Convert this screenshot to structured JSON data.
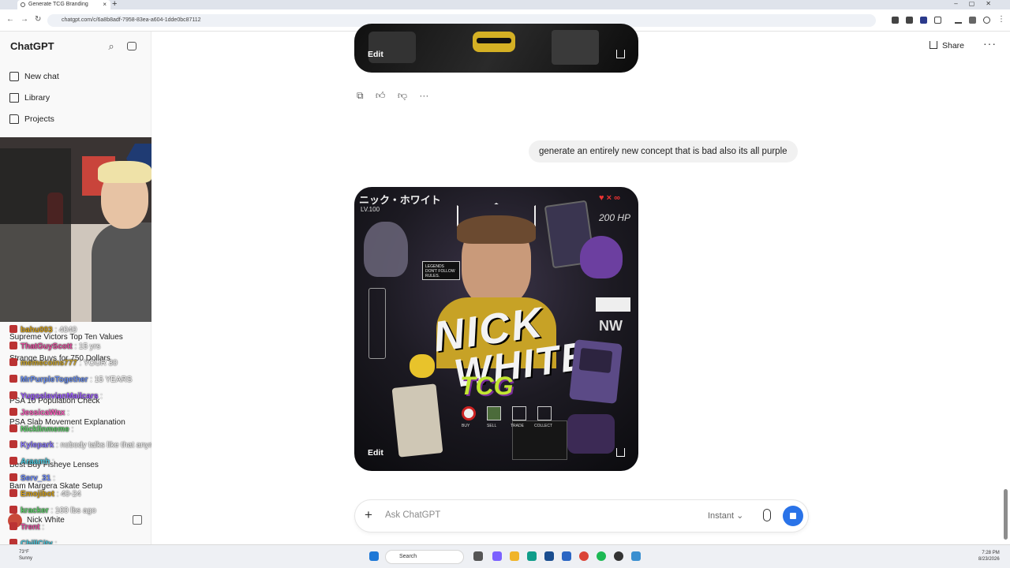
{
  "browser": {
    "tab_title": "Generate TCG Branding",
    "url": "chatgpt.com/c/6a8b8adf-7958-83ea-a604-1dde0bc87112",
    "new_tab": "+",
    "tab_close": "×"
  },
  "sidebar": {
    "brand": "ChatGPT",
    "nav": [
      {
        "label": "New chat"
      },
      {
        "label": "Library"
      },
      {
        "label": "Projects"
      }
    ],
    "history": [
      "Supreme Victors Top Ten Values",
      "Strange Buys for 750 Dollars",
      "PSA 10 Population Check",
      "PSA Slab Movement Explanation",
      "Best Buy Fisheye Lenses",
      "Bam Margera Skate Setup"
    ],
    "user_name": "Nick White"
  },
  "stream_chat": [
    {
      "user": "bahu003",
      "msg": ": 4040",
      "color": "#d4a017"
    },
    {
      "user": "ThatGuyScott",
      "msg": ": 15 yrs",
      "color": "#e54e9e"
    },
    {
      "user": "memecoins777",
      "msg": ": YOUR 30",
      "color": "#c9a227"
    },
    {
      "user": "MrPurpleTogether",
      "msg": ": 15 YEARS",
      "color": "#6b8ff0"
    },
    {
      "user": "YugoslavianMailcars",
      "msg": ":",
      "color": "#9b59ff"
    },
    {
      "user": "JessicaWax",
      "msg": ":",
      "color": "#ff5fbf"
    },
    {
      "user": "Nicklinmeme",
      "msg": ":",
      "color": "#5fd36b"
    },
    {
      "user": "Kylepark",
      "msg": ": nobody talks like that anymore",
      "color": "#8e7cff"
    },
    {
      "user": "Araamh",
      "msg": ":",
      "color": "#48c4d9"
    },
    {
      "user": "Serv_31",
      "msg": ":",
      "color": "#6e8cff"
    },
    {
      "user": "Emojibot",
      "msg": ": 40-24",
      "color": "#d4a017"
    },
    {
      "user": "kracker",
      "msg": ": 100 lbs ago",
      "color": "#5fd36b"
    },
    {
      "user": "Trent",
      "msg": ":",
      "color": "#e54e9e"
    },
    {
      "user": "ChillCity",
      "msg": ":",
      "color": "#48c4d9"
    }
  ],
  "main": {
    "share_label": "Share",
    "more_label": "···",
    "edit_label": "Edit",
    "more_actions": "···",
    "user_message": "generate an entirely new concept that is bad also its all purple",
    "card": {
      "jp_name": "ニック・ホワイト",
      "level": "LV.100",
      "hp": "200 HP",
      "lives": "♥ × ∞",
      "title_line1": "NICK",
      "title_line2": "WHITE",
      "title_line3": "TCG",
      "sign": "LEGENDS DON'T FOLLOW RULES.",
      "badge": "NW",
      "buttons": [
        "BUY",
        "SELL",
        "TRADE",
        "COLLECT"
      ]
    },
    "composer_placeholder": "Ask ChatGPT",
    "model_label": "Instant",
    "plus": "+"
  },
  "taskbar": {
    "search_label": "Search",
    "time": "7:28 PM",
    "date": "8/23/2026",
    "weather_temp": "73°F",
    "weather_desc": "Sunny"
  },
  "colors": {
    "accent": "#2a73e8",
    "purple": "#a067d8",
    "bubble": "#f1f1f1"
  }
}
